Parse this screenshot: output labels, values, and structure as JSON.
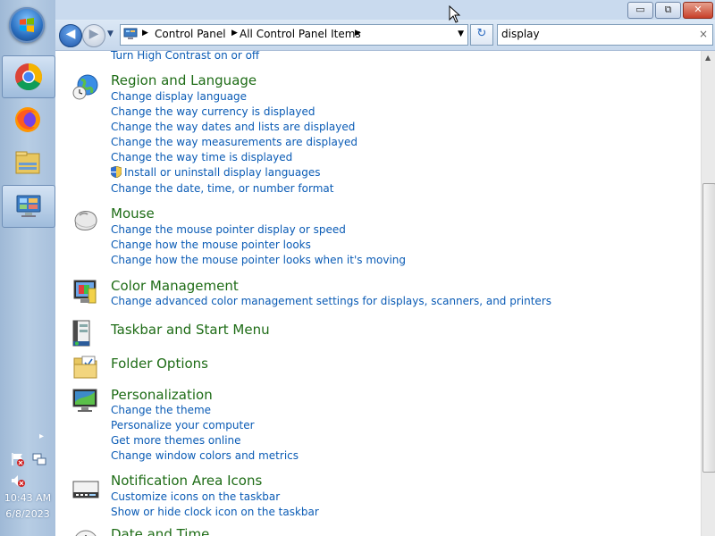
{
  "window": {
    "minimize_glyph": "▭",
    "maximize_glyph": "⧉",
    "close_glyph": "✕"
  },
  "navigation": {
    "back_glyph": "◀",
    "forward_glyph": "▶",
    "breadcrumbs": [
      "Control Panel",
      "All Control Panel Items"
    ],
    "refresh_glyph": "↻"
  },
  "search": {
    "value": "display",
    "clear_glyph": "×"
  },
  "taskbar": {
    "apps": [
      "start-orb",
      "chrome-icon",
      "firefox-icon",
      "file-explorer-icon",
      "control-panel-icon"
    ],
    "tray_expand_glyph": "▸",
    "time": "10:43 AM",
    "date": "6/8/2023"
  },
  "top_partial_link": "Turn High Contrast on or off",
  "categories": [
    {
      "title": "Region and Language",
      "icon": "globe-clock-icon",
      "links": [
        "Change display language",
        "Change the way currency is displayed",
        "Change the way dates and lists are displayed",
        "Change the way measurements are displayed",
        "Change the way time is displayed",
        "Install or uninstall display languages",
        "Change the date, time, or number format"
      ]
    },
    {
      "title": "Mouse",
      "icon": "mouse-icon",
      "links": [
        "Change the mouse pointer display or speed",
        "Change how the mouse pointer looks",
        "Change how the mouse pointer looks when it's moving"
      ]
    },
    {
      "title": "Color Management",
      "icon": "color-management-icon",
      "links": [
        "Change advanced color management settings for displays, scanners, and printers"
      ]
    },
    {
      "title": "Taskbar and Start Menu",
      "icon": "taskbar-icon",
      "links": []
    },
    {
      "title": "Folder Options",
      "icon": "folder-options-icon",
      "links": []
    },
    {
      "title": "Personalization",
      "icon": "personalization-icon",
      "links": [
        "Change the theme",
        "Personalize your computer",
        "Get more themes online",
        "Change window colors and metrics"
      ]
    },
    {
      "title": "Notification Area Icons",
      "icon": "notification-area-icon",
      "links": [
        "Customize icons on the taskbar",
        "Show or hide clock icon on the taskbar"
      ]
    },
    {
      "title": "Date and Time",
      "icon": "date-time-icon",
      "links": []
    }
  ]
}
